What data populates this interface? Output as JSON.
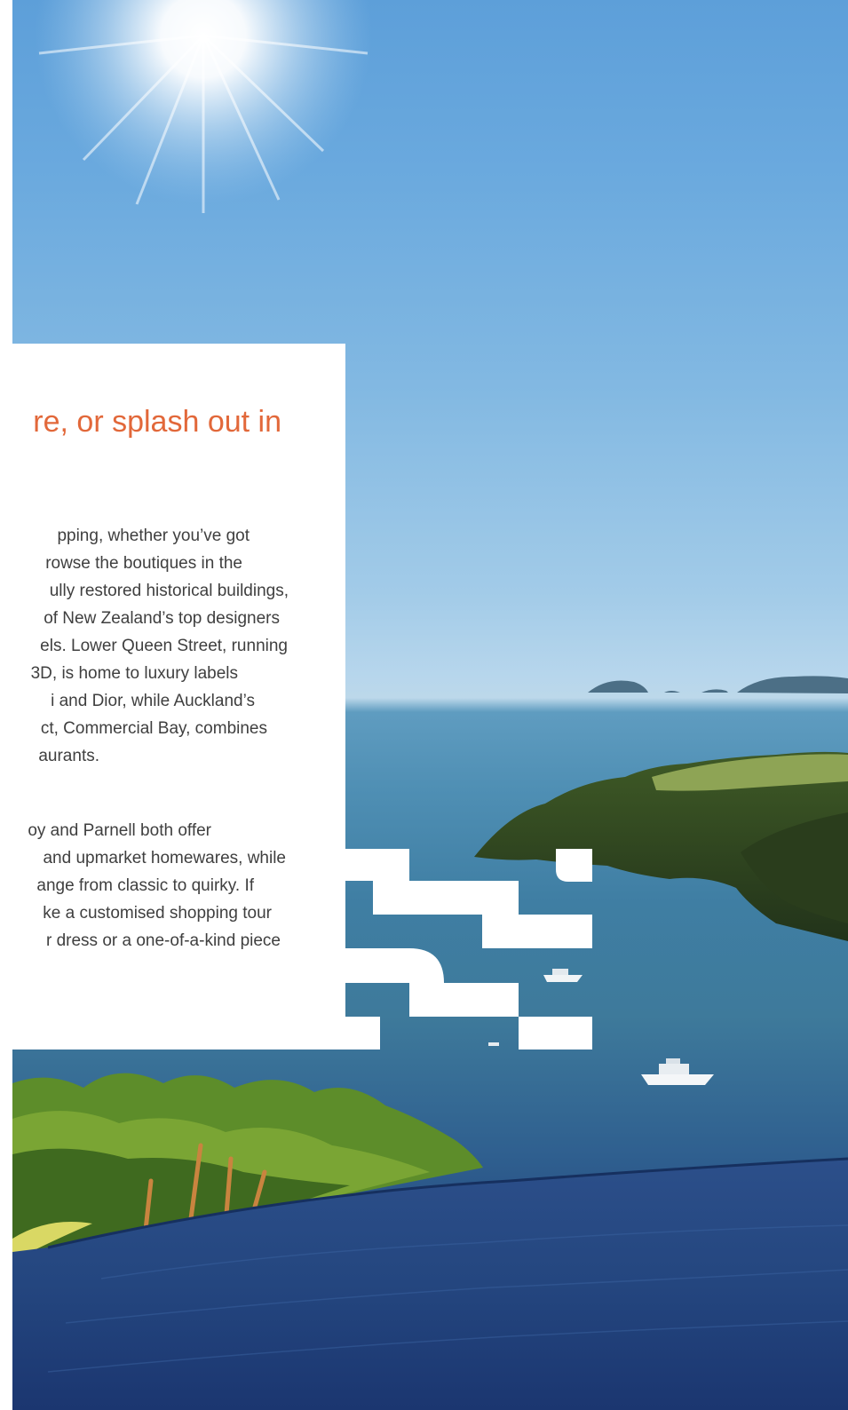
{
  "article": {
    "heading_fragment": "re, or splash out in",
    "paragraph_1": [
      "pping, whether you’ve got",
      "rowse the boutiques in the",
      "ully restored historical buildings,",
      " of New Zealand’s top designers",
      "els. Lower Queen Street, running",
      "3D, is home to luxury labels",
      "i and Dior, while Auckland’s",
      "ct, Commercial Bay, combines",
      "aurants."
    ],
    "paragraph_2": [
      "oy and Parnell both offer",
      "and upmarket homewares, while",
      "ange from classic to quirky. If",
      "ke a customised shopping tour",
      "r dress or a one-of-a-kind piece"
    ]
  },
  "colors": {
    "heading": "#e2683a",
    "body_text": "#3f3f3f",
    "panel": "#ffffff"
  },
  "photo": {
    "icon": "landscape-photo"
  }
}
